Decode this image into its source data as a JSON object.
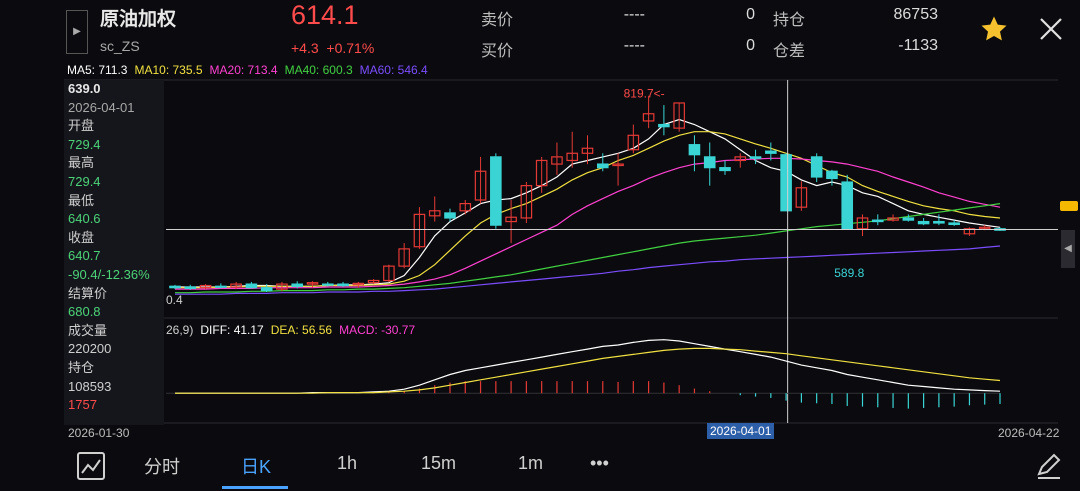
{
  "header": {
    "name": "原油加权",
    "code": "sc_ZS",
    "price": "614.1",
    "change": "+4.3",
    "change_pct": "+0.71%",
    "sell_label": "卖价",
    "sell_price": "----",
    "sell_vol": "0",
    "buy_label": "买价",
    "buy_price": "----",
    "buy_vol": "0",
    "oi_label": "持仓",
    "oi_value": "86753",
    "oi_diff_label": "仓差",
    "oi_diff_value": "-1133"
  },
  "ma_legend": [
    {
      "text": "MA5: 711.3",
      "color": "#ffffff"
    },
    {
      "text": "MA10: 735.5",
      "color": "#f0e040"
    },
    {
      "text": "MA20: 713.4",
      "color": "#ff40d0"
    },
    {
      "text": "MA40: 600.3",
      "color": "#40d040"
    },
    {
      "text": "MA60: 546.4",
      "color": "#7a4dff"
    }
  ],
  "macd_legend": [
    {
      "text": "26,9)",
      "color": "#cfcfcf"
    },
    {
      "text": "DIFF: 41.17",
      "color": "#ffffff"
    },
    {
      "text": "DEA: 56.56",
      "color": "#f0e040"
    },
    {
      "text": "MACD: -30.77",
      "color": "#ff40d0"
    }
  ],
  "side_panel": {
    "price": "639.0",
    "date": "2026-04-01",
    "open_label": "开盘",
    "open": "729.4",
    "high_label": "最高",
    "high": "729.4",
    "low_label": "最低",
    "low": "640.6",
    "close_label": "收盘",
    "close": "640.7",
    "change": "-90.4/-12.36%",
    "settle_label": "结算价",
    "settle": "680.8",
    "volume_label": "成交量",
    "volume": "220200",
    "oi_label": "持仓",
    "oi": "108593",
    "oi_change": "1757"
  },
  "axis": {
    "start_date": "2026-01-30",
    "cursor_date": "2026-04-01",
    "end_date": "2026-04-22",
    "left_value": "0.4"
  },
  "annotations": {
    "high": "819.7<-",
    "low": "589.8"
  },
  "tabs": [
    "分时",
    "日K",
    "1h",
    "15m",
    "1m",
    "•••"
  ],
  "active_tab": "日K",
  "colors": {
    "up": "#e53935",
    "down": "#3ad4d4",
    "background": "#0b0b0f",
    "crosshair": "#d0d0d0"
  },
  "chart_data": [
    {
      "type": "candlestick",
      "ylim": [
        520,
        840
      ],
      "candles": [
        [
          560,
          562,
          556,
          558
        ],
        [
          559,
          562,
          555,
          557
        ],
        [
          558,
          563,
          556,
          561
        ],
        [
          560,
          564,
          557,
          559
        ],
        [
          559,
          566,
          556,
          563
        ],
        [
          563,
          566,
          557,
          558
        ],
        [
          558,
          563,
          552,
          554
        ],
        [
          556,
          566,
          553,
          563
        ],
        [
          563,
          567,
          557,
          560
        ],
        [
          563,
          567,
          558,
          565
        ],
        [
          563,
          566,
          560,
          562
        ],
        [
          563,
          566,
          559,
          561
        ],
        [
          562,
          566,
          558,
          564
        ],
        [
          565,
          570,
          563,
          568
        ],
        [
          568,
          590,
          566,
          588
        ],
        [
          588,
          620,
          585,
          612
        ],
        [
          615,
          670,
          612,
          660
        ],
        [
          658,
          685,
          650,
          665
        ],
        [
          662,
          668,
          650,
          655
        ],
        [
          665,
          680,
          660,
          675
        ],
        [
          680,
          740,
          675,
          720
        ],
        [
          740,
          745,
          640,
          645
        ],
        [
          650,
          680,
          620,
          656
        ],
        [
          655,
          705,
          648,
          700
        ],
        [
          700,
          740,
          690,
          735
        ],
        [
          730,
          760,
          715,
          740
        ],
        [
          735,
          775,
          725,
          745
        ],
        [
          745,
          770,
          730,
          752
        ],
        [
          730,
          745,
          720,
          725
        ],
        [
          728,
          745,
          700,
          730
        ],
        [
          750,
          785,
          745,
          770
        ],
        [
          790,
          825,
          780,
          800
        ],
        [
          785,
          812,
          770,
          782
        ],
        [
          780,
          815,
          775,
          815
        ],
        [
          757,
          770,
          720,
          743
        ],
        [
          740,
          760,
          700,
          725
        ],
        [
          725,
          735,
          715,
          721
        ],
        [
          735,
          745,
          725,
          740
        ],
        [
          740,
          750,
          730,
          738
        ],
        [
          748,
          760,
          735,
          745
        ],
        [
          743,
          745,
          665,
          665
        ],
        [
          670,
          706,
          665,
          697
        ],
        [
          740,
          745,
          705,
          712
        ],
        [
          720,
          722,
          700,
          710
        ],
        [
          705,
          715,
          640,
          640
        ],
        [
          640,
          660,
          630,
          655
        ],
        [
          652,
          660,
          645,
          650
        ],
        [
          652,
          660,
          650,
          655
        ],
        [
          655,
          660,
          650,
          652
        ],
        [
          650,
          655,
          645,
          647
        ],
        [
          650,
          660,
          645,
          648
        ],
        [
          648,
          652,
          644,
          646
        ],
        [
          633,
          642,
          630,
          640
        ],
        [
          640,
          645,
          638,
          642
        ],
        [
          640,
          642,
          637,
          638
        ]
      ],
      "annotations": [
        {
          "text": "819.7<-",
          "value": 819.7
        },
        {
          "text": "589.8",
          "value": 589.8
        }
      ]
    },
    {
      "type": "line",
      "series": [
        {
          "name": "MA5",
          "color": "#ffffff",
          "values": [
            559,
            559,
            559,
            559,
            560,
            561,
            561,
            560,
            560,
            560,
            561,
            562,
            562,
            563,
            565,
            575,
            600,
            630,
            650,
            662,
            675,
            680,
            682,
            690,
            700,
            712,
            730,
            735,
            740,
            745,
            752,
            765,
            785,
            792,
            785,
            775,
            765,
            750,
            735,
            725,
            720,
            708,
            700,
            705,
            700,
            690,
            685,
            675,
            665,
            660,
            656,
            652,
            648,
            645,
            642
          ]
        },
        {
          "name": "MA10",
          "color": "#f0e040",
          "values": [
            558,
            558,
            558,
            559,
            559,
            560,
            560,
            560,
            560,
            560,
            561,
            561,
            561,
            562,
            563,
            567,
            575,
            590,
            610,
            630,
            648,
            660,
            668,
            675,
            685,
            695,
            708,
            718,
            725,
            735,
            742,
            752,
            762,
            770,
            775,
            775,
            772,
            765,
            758,
            752,
            745,
            738,
            728,
            718,
            712,
            700,
            692,
            685,
            678,
            672,
            668,
            665,
            660,
            657,
            655
          ]
        },
        {
          "name": "MA20",
          "color": "#ff40d0",
          "values": [
            556,
            556,
            556,
            557,
            557,
            557,
            558,
            558,
            558,
            558,
            559,
            559,
            559,
            560,
            561,
            563,
            566,
            570,
            576,
            585,
            595,
            605,
            615,
            625,
            635,
            645,
            660,
            672,
            682,
            692,
            700,
            710,
            718,
            725,
            730,
            732,
            735,
            736,
            737,
            738,
            738,
            737,
            735,
            733,
            730,
            725,
            720,
            712,
            705,
            698,
            690,
            684,
            678,
            674,
            670
          ]
        },
        {
          "name": "MA40",
          "color": "#40d040",
          "values": [
            551,
            551,
            552,
            552,
            552,
            553,
            553,
            554,
            554,
            554,
            555,
            555,
            556,
            556,
            557,
            558,
            560,
            562,
            564,
            567,
            570,
            573,
            576,
            580,
            584,
            588,
            592,
            596,
            600,
            604,
            608,
            612,
            616,
            620,
            623,
            625,
            627,
            629,
            631,
            634,
            637,
            640,
            643,
            645,
            647,
            649,
            651,
            654,
            657,
            660,
            663,
            666,
            669,
            672,
            675
          ]
        },
        {
          "name": "MA60",
          "color": "#7a4dff",
          "values": [
            549,
            549,
            549,
            549,
            550,
            550,
            550,
            551,
            551,
            551,
            552,
            552,
            552,
            553,
            553,
            554,
            555,
            556,
            558,
            560,
            562,
            564,
            566,
            568,
            570,
            572,
            574,
            576,
            578,
            581,
            583,
            586,
            588,
            590,
            592,
            594,
            595,
            597,
            598,
            599,
            600,
            601,
            602,
            603,
            604,
            605,
            606,
            607,
            608,
            609,
            610,
            611,
            612,
            614,
            616
          ]
        }
      ]
    },
    {
      "type": "macd",
      "ylim": [
        -40,
        90
      ],
      "series": [
        {
          "name": "DIFF",
          "color": "#ffffff",
          "values": [
            0,
            0,
            0,
            0,
            0,
            0,
            0,
            0,
            0,
            1,
            1,
            1,
            1,
            2,
            3,
            6,
            12,
            20,
            28,
            34,
            38,
            42,
            46,
            50,
            54,
            58,
            62,
            66,
            70,
            72,
            76,
            79,
            80,
            78,
            74,
            70,
            66,
            62,
            58,
            54,
            48,
            42,
            38,
            34,
            28,
            24,
            20,
            16,
            12,
            10,
            8,
            6,
            5,
            4,
            3
          ]
        },
        {
          "name": "DEA",
          "color": "#f0e040",
          "values": [
            0,
            0,
            0,
            0,
            0,
            0,
            0,
            0,
            0,
            0,
            1,
            1,
            1,
            1,
            2,
            3,
            5,
            8,
            12,
            16,
            20,
            24,
            28,
            32,
            36,
            40,
            44,
            48,
            52,
            55,
            58,
            61,
            64,
            66,
            67,
            67,
            66,
            65,
            63,
            61,
            59,
            56,
            53,
            50,
            47,
            44,
            41,
            38,
            35,
            32,
            29,
            26,
            23,
            21,
            19
          ]
        },
        {
          "name": "MACD",
          "color": "#ff40d0",
          "values": [
            0,
            0,
            0,
            0,
            0,
            0,
            0,
            0,
            0,
            1,
            0,
            0,
            0,
            1,
            1,
            3,
            7,
            12,
            16,
            18,
            18,
            18,
            18,
            18,
            18,
            18,
            18,
            18,
            18,
            17,
            18,
            18,
            16,
            12,
            7,
            3,
            0,
            -3,
            -5,
            -7,
            -11,
            -14,
            -15,
            -16,
            -19,
            -20,
            -21,
            -22,
            -23,
            -22,
            -21,
            -20,
            -18,
            -17,
            -16
          ]
        }
      ]
    }
  ]
}
